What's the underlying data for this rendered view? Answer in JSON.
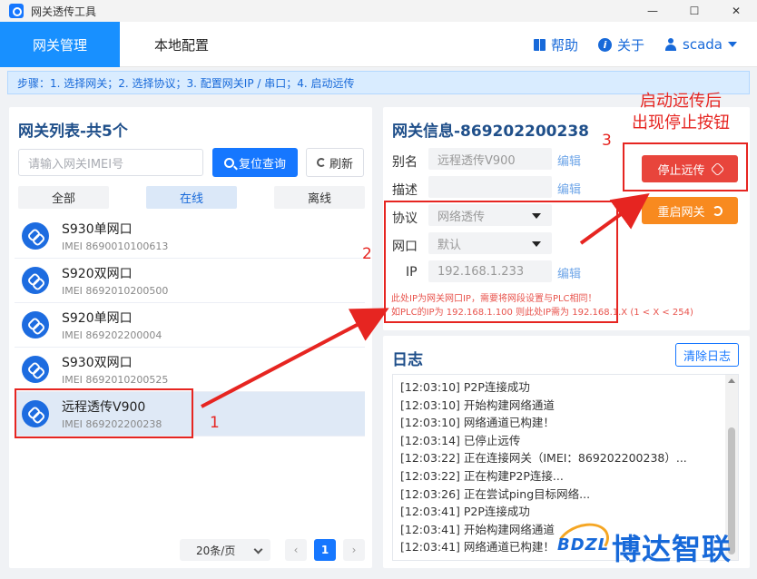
{
  "window": {
    "title": "网关透传工具",
    "controls": [
      "—",
      "☐",
      "✕"
    ]
  },
  "nav": {
    "tabs": [
      {
        "label": "网关管理"
      },
      {
        "label": "本地配置"
      }
    ],
    "help_label": "帮助",
    "about_label": "关于",
    "user_label": "scada"
  },
  "steps_text": "步骤：1. 选择网关；2. 选择协议；3. 配置网关IP / 串口；4. 启动远传",
  "gateway_list": {
    "title": "网关列表-共5个",
    "search_placeholder": "请输入网关IMEI号",
    "query_label": "复位查询",
    "refresh_label": "刷新",
    "filters": [
      "全部",
      "在线",
      "离线"
    ],
    "items": [
      {
        "name": "S930单网口",
        "imei": "IMEI 8690010100613"
      },
      {
        "name": "S920双网口",
        "imei": "IMEI 8692010200500"
      },
      {
        "name": "S920单网口",
        "imei": "IMEI 869202200004"
      },
      {
        "name": "S930双网口",
        "imei": "IMEI 8692010200525"
      },
      {
        "name": "远程透传V900",
        "imei": "IMEI 869202200238"
      }
    ],
    "selected_index": 4,
    "pager": {
      "size_label": "20条/页",
      "prev": "‹",
      "current": "1",
      "next": "›"
    }
  },
  "gateway_info": {
    "title": "网关信息-869202200238",
    "alias_label": "别名",
    "alias_value": "远程透传V900",
    "desc_label": "描述",
    "desc_value": "",
    "protocol_label": "协议",
    "protocol_value": "网络透传",
    "port_label": "网口",
    "port_value": "默认",
    "ip_label": "IP",
    "ip_value": "192.168.1.233",
    "edit_label": "编辑",
    "hint_line1": "此处IP为网关网口IP，需要将网段设置与PLC相同！",
    "hint_line2": "如PLC的IP为 192.168.1.100 则此处IP需为 192.168.1.X (1 < X < 254)",
    "stop_label": "停止远传",
    "restart_label": "重启网关"
  },
  "log": {
    "title": "日志",
    "clear_label": "清除日志",
    "lines": [
      "[12:03:10] P2P连接成功",
      "[12:03:10] 开始构建网络通道",
      "[12:03:10] 网络通道已构建！",
      "[12:03:14] 已停止远传",
      "[12:03:22] 正在连接网关（IMEI：869202200238）...",
      "[12:03:22] 正在构建P2P连接...",
      "[12:03:26] 正在尝试ping目标网络...",
      "[12:03:41] P2P连接成功",
      "[12:03:41] 开始构建网络通道",
      "[12:03:41] 网络通道已构建！"
    ]
  },
  "annotations": {
    "n1": "1",
    "n2": "2",
    "n3": "3",
    "title_line1": "启动远传后",
    "title_line2": "出现停止按钮",
    "color": "#e62521"
  },
  "logo": {
    "abbr": "BDZL",
    "name": "博达智联"
  }
}
